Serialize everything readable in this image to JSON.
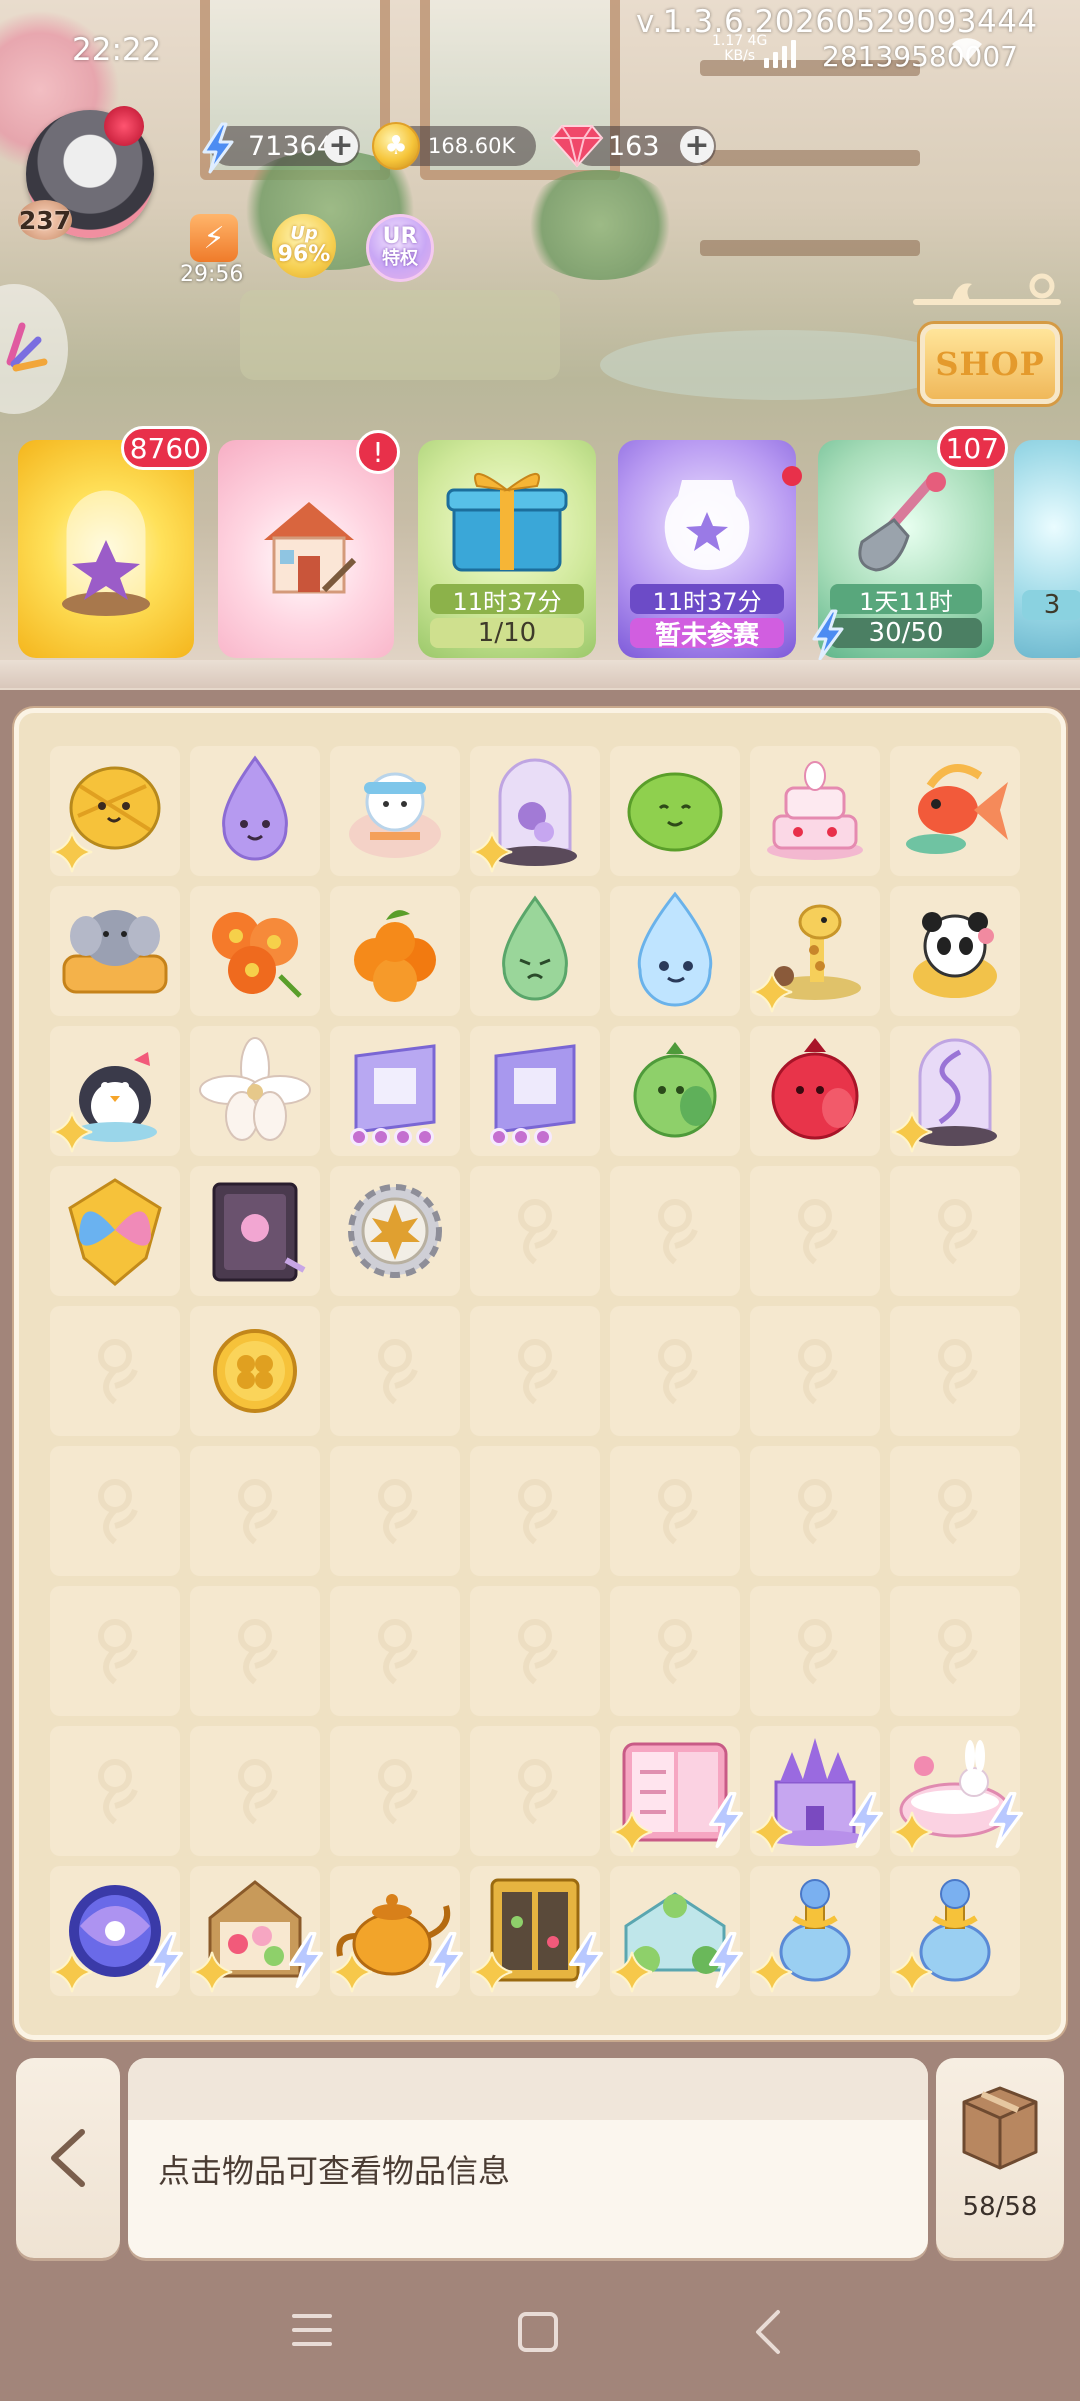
{
  "status_bar": {
    "time": "22:22",
    "version": "v.1.3.6.20260529093444",
    "net_rate_value": "1.17",
    "net_rate_unit": "KB/s",
    "network_type": "4G",
    "user_id": "28139580007"
  },
  "player": {
    "level": "237"
  },
  "currencies": {
    "energy": "71364",
    "coins": "168.60K",
    "gems": "163"
  },
  "status_icons": {
    "stamina_timer": "29:56",
    "up_label": "Up",
    "up_percent": "96%",
    "ur_label": "UR",
    "ur_sub": "特权"
  },
  "shop": {
    "label": "SHOP"
  },
  "event_cards": [
    {
      "badge": "8760",
      "timer": "",
      "progress": ""
    },
    {
      "badge": "!",
      "timer": "",
      "progress": ""
    },
    {
      "badge": "",
      "timer": "11时37分",
      "progress": "1/10"
    },
    {
      "badge": "",
      "timer": "11时37分",
      "progress": "暂未参赛"
    },
    {
      "badge": "107",
      "timer": "1天11时",
      "progress": "30/50"
    },
    {
      "badge": "",
      "timer": "",
      "progress": "3"
    }
  ],
  "board": {
    "items": [
      [
        "durian-icon",
        "water-drop-purple-icon",
        "snowman-seal-icon",
        "glass-dome-flower-icon",
        "lime-icon",
        "layered-cake-icon",
        "goldfish-icon"
      ],
      [
        "elephant-sofa-icon",
        "orange-lily-icon",
        "tangerine-bunch-icon",
        "water-drop-green-icon",
        "water-drop-blue-icon",
        "giraffe-icon",
        "panda-icon"
      ],
      [
        "penguin-icon",
        "magnolia-icon",
        "ticket-four-dots-icon",
        "ticket-three-dots-icon",
        "green-pomegranate-icon",
        "red-pomegranate-icon",
        "glass-dome-vine-icon"
      ],
      [
        "butterfly-emblem-icon",
        "flower-book-icon",
        "maple-gear-medal-icon",
        "",
        "",
        "",
        ""
      ],
      [
        "",
        "clover-coin-icon",
        "",
        "",
        "",
        "",
        ""
      ],
      [
        "",
        "",
        "",
        "",
        "",
        "",
        ""
      ],
      [
        "",
        "",
        "",
        "",
        "",
        "",
        ""
      ],
      [
        "",
        "",
        "",
        "",
        "pink-fridge-icon",
        "purple-castle-icon",
        "bunny-bathtub-icon"
      ],
      [
        "galaxy-portal-icon",
        "flower-greenhouse-icon",
        "golden-teapot-icon",
        "golden-cabinet-icon",
        "glass-greenhouse-icon",
        "perfume-bottle-icon",
        "perfume-bottle-icon"
      ]
    ]
  },
  "info_panel": {
    "text": "点击物品可查看物品信息"
  },
  "inventory": {
    "count": "58/58"
  },
  "colors": {
    "board_bg": "#efe1c3",
    "cell_bg": "#f5e8cf",
    "badge_red": "#e8304a",
    "frame_brown": "#a2857a"
  }
}
